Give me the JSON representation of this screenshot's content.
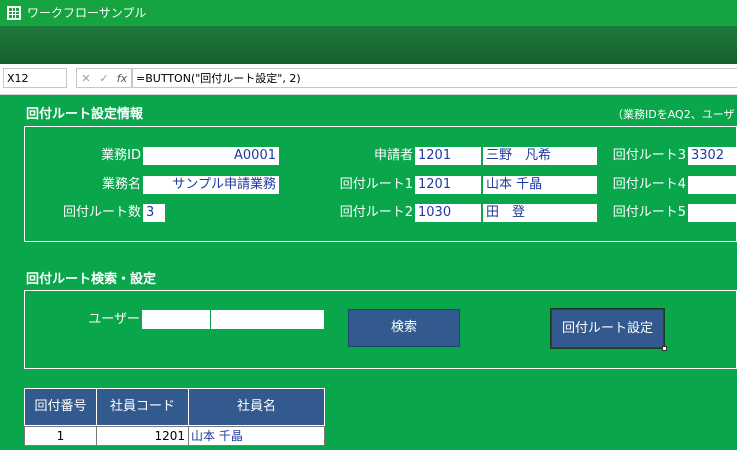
{
  "window": {
    "title": "ワークフローサンプル"
  },
  "formula_bar": {
    "name_box": "X12",
    "formula": "=BUTTON(\"回付ルート設定\", 2)"
  },
  "section1": {
    "title": "回付ルート設定情報",
    "note": "（業務IDをAQ2、ユーザ",
    "fields": {
      "job_id_label": "業務ID",
      "job_id": "A0001",
      "job_name_label": "業務名",
      "job_name": "サンプル申請業務",
      "route_count_label": "回付ルート数",
      "route_count": "3",
      "applicant_label": "申請者",
      "applicant_code": "1201",
      "applicant_name": "三野　凡希",
      "route1_label": "回付ルート1",
      "route1_code": "1201",
      "route1_name": "山本 千晶",
      "route2_label": "回付ルート2",
      "route2_code": "1030",
      "route2_name": "田　登",
      "route3_label": "回付ルート3",
      "route3_code": "3302",
      "route4_label": "回付ルート4",
      "route4_code": "",
      "route5_label": "回付ルート5",
      "route5_code": ""
    }
  },
  "section2": {
    "title": "回付ルート検索・設定",
    "user_label": "ユーザー",
    "user_code": "",
    "user_name": "",
    "search_button": "検索",
    "set_route_button": "回付ルート設定"
  },
  "table": {
    "headers": [
      "回付番号",
      "社員コード",
      "社員名"
    ],
    "rows": [
      {
        "no": "1",
        "code": "1201",
        "name": "山本 千晶"
      }
    ]
  },
  "colors": {
    "sheet_bg": "#0aa64b",
    "header_bg": "#335a8f",
    "title_bar": "#15a43f"
  }
}
